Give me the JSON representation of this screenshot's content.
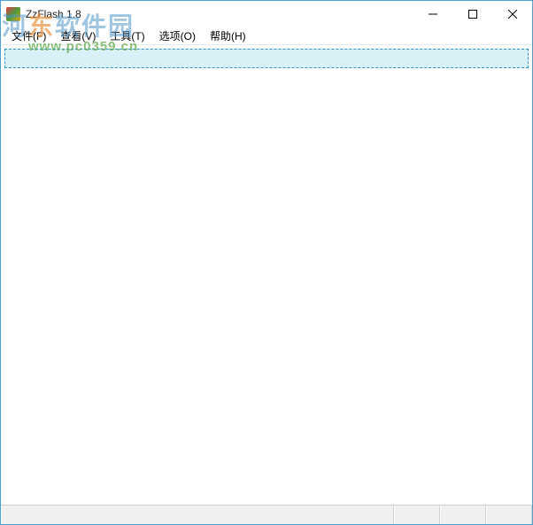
{
  "title": "ZzFlash 1.8",
  "menu": {
    "file": "文件(F)",
    "view": "查看(V)",
    "tools": "工具(T)",
    "options": "选项(O)",
    "help": "帮助(H)"
  },
  "watermark": {
    "text_prefix": "河",
    "text_accent": "东",
    "text_suffix": "软件园",
    "url": "www.pc0359.cn"
  }
}
